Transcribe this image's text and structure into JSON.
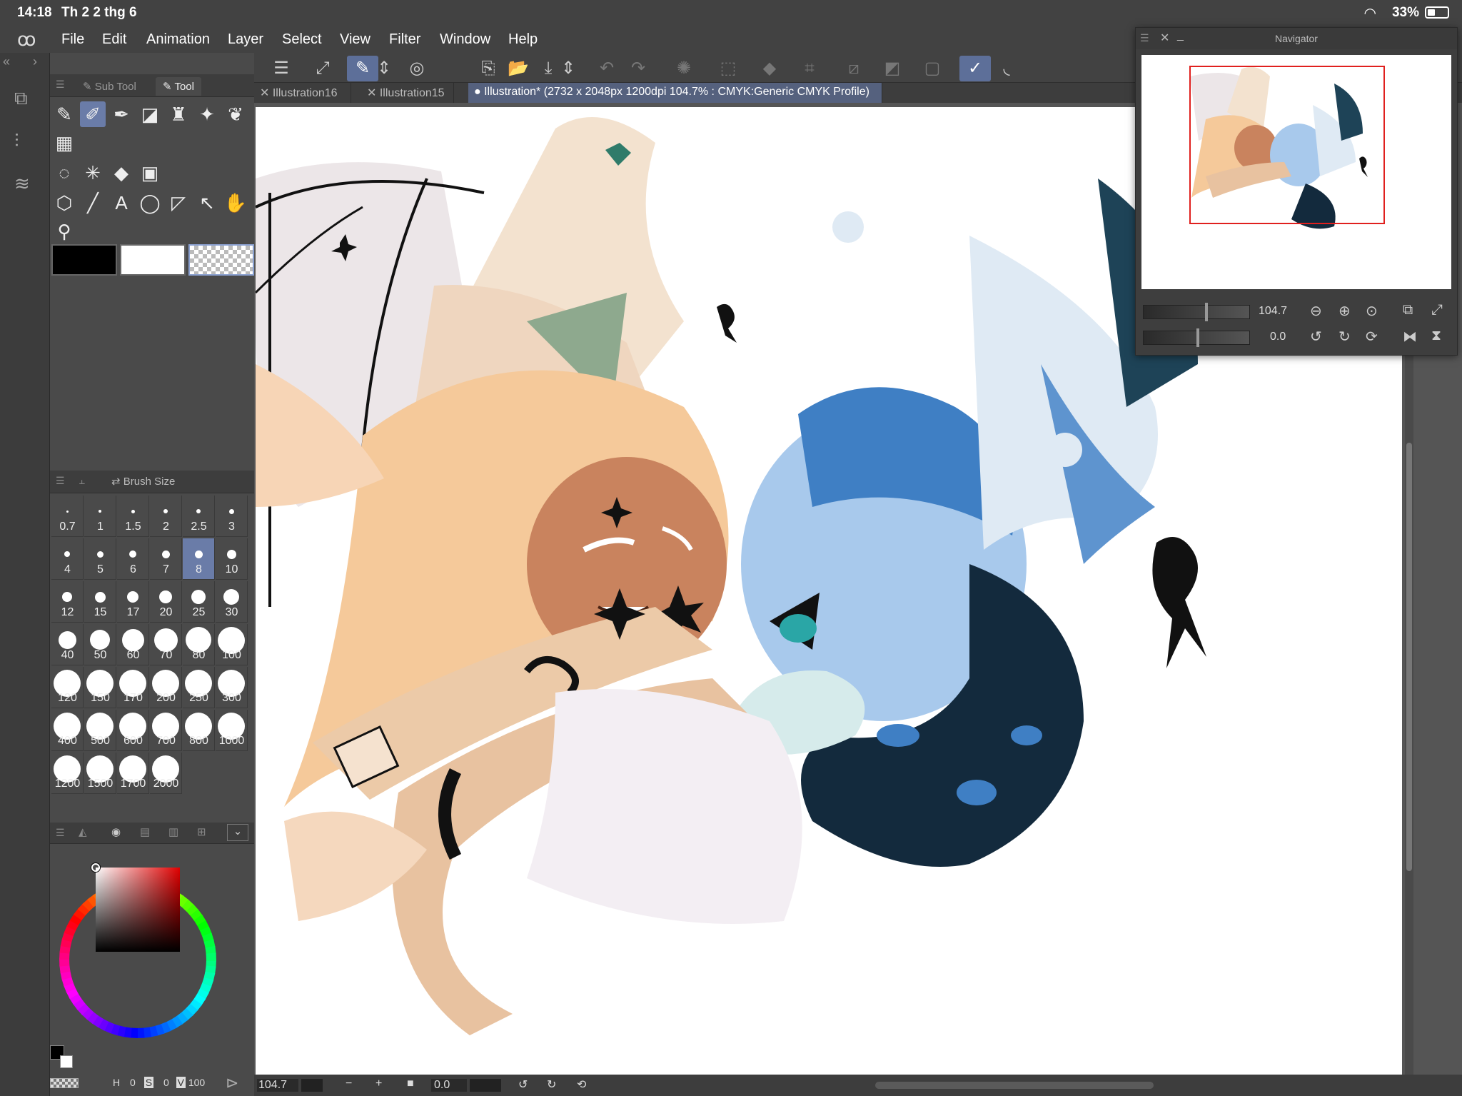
{
  "status": {
    "time": "14:18",
    "date": "Th 2 2 thg 6",
    "battery": "33%"
  },
  "menu": [
    "File",
    "Edit",
    "Animation",
    "Layer",
    "Select",
    "View",
    "Filter",
    "Window",
    "Help"
  ],
  "tool_panel": {
    "tabs": [
      "Sub Tool",
      "Tool"
    ]
  },
  "brush_panel": {
    "title": "Brush Size",
    "sizes": [
      "0.7",
      "1",
      "1.5",
      "2",
      "2.5",
      "3",
      "4",
      "5",
      "6",
      "7",
      "8",
      "10",
      "12",
      "15",
      "17",
      "20",
      "25",
      "30",
      "40",
      "50",
      "60",
      "70",
      "80",
      "100",
      "120",
      "150",
      "170",
      "200",
      "250",
      "300",
      "400",
      "500",
      "600",
      "700",
      "800",
      "1000",
      "1200",
      "1500",
      "1700",
      "2000"
    ],
    "selected": "8"
  },
  "color_panel": {
    "h_label": "H",
    "h": "0",
    "s_label": "S",
    "s": "0",
    "v_label": "V",
    "v": "100"
  },
  "doc_tabs": [
    {
      "label": "Illustration16"
    },
    {
      "label": "Illustration15"
    },
    {
      "label": "Illustration* (2732 x 2048px 1200dpi 104.7% : CMYK:Generic CMYK Profile)"
    }
  ],
  "bottom": {
    "zoom": "104.7",
    "rotation": "0.0"
  },
  "navigator": {
    "title": "Navigator",
    "zoom": "104.7",
    "rotation": "0.0"
  }
}
